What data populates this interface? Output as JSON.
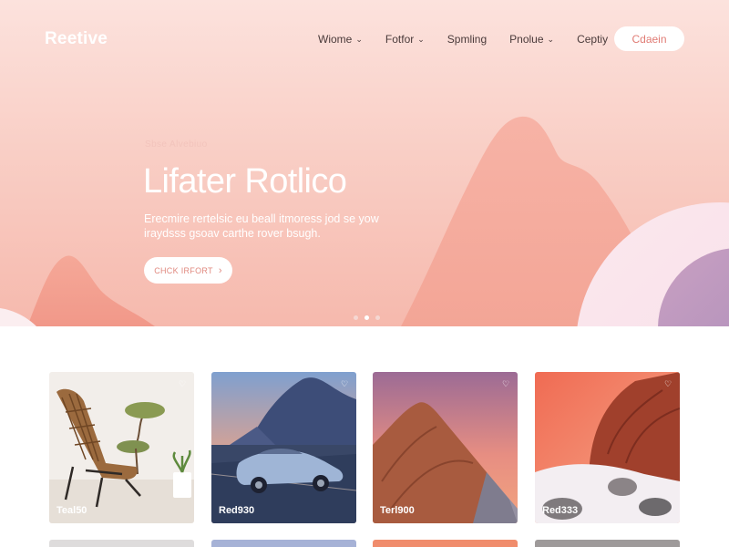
{
  "header": {
    "logo": "Reetive",
    "nav": [
      {
        "label": "Wiome",
        "dropdown": true
      },
      {
        "label": "Fotfor",
        "dropdown": true
      },
      {
        "label": "Spmling",
        "dropdown": false
      },
      {
        "label": "Pnolue",
        "dropdown": true
      },
      {
        "label": "Ceptiy",
        "dropdown": false
      }
    ],
    "login_label": "Cdaein"
  },
  "hero": {
    "eyebrow": "Sbse Alvebiuo",
    "headline": "Lifater Rotlico",
    "subtext": "Erecmire rertelsic eu beall itmoress jod se yow iraydsss gsoav carthe rover bsugh.",
    "cta_label": "CHCK IRFORT",
    "slides": 3,
    "active_slide": 1
  },
  "cards": [
    {
      "price": "Teal50",
      "scene": "chair-bonsai"
    },
    {
      "price": "Red930",
      "scene": "car-mountain"
    },
    {
      "price": "Terl900",
      "scene": "red-mountain"
    },
    {
      "price": "Red333",
      "scene": "red-rock"
    }
  ],
  "icons": {
    "nav_dropdown": "chevron-down-icon",
    "cta_arrow": "chevron-right-icon",
    "card_fav": "heart-icon"
  },
  "colors": {
    "hero_top": "#fce2dd",
    "hero_bottom": "#f6b9ad",
    "accent": "#e07b74"
  }
}
